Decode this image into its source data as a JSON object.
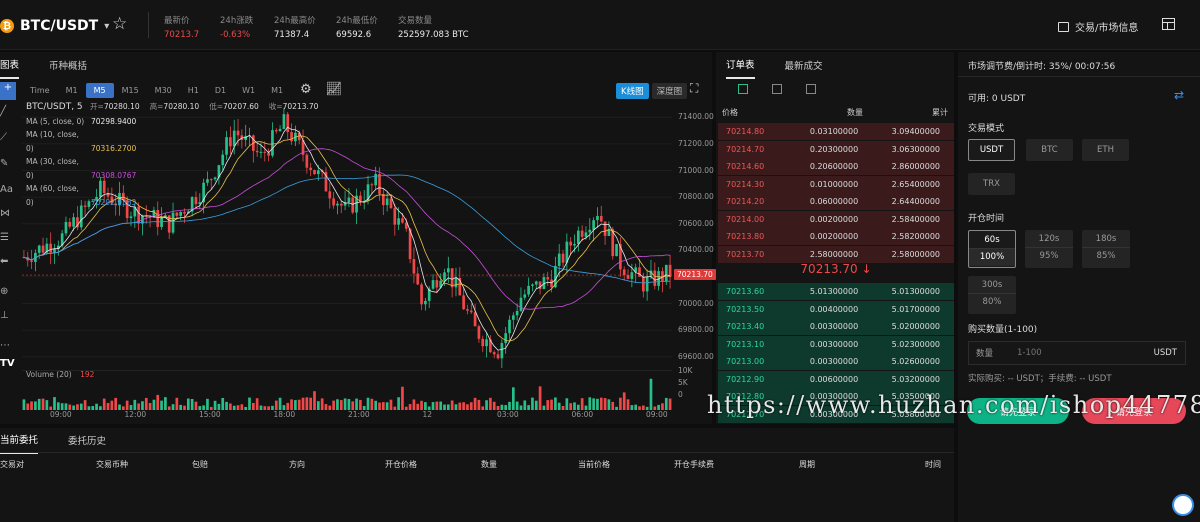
{
  "header": {
    "pair": "BTC/USDT",
    "coin_glyph": "₿",
    "stats": [
      {
        "label": "最新价",
        "value": "70213.7",
        "color": "red"
      },
      {
        "label": "24h涨跌",
        "value": "-0.63%",
        "color": "red"
      },
      {
        "label": "24h最高价",
        "value": "71387.4",
        "color": "white"
      },
      {
        "label": "24h最低价",
        "value": "69592.6",
        "color": "white"
      },
      {
        "label": "交易数量",
        "value": "252597.083 BTC",
        "color": "white"
      }
    ],
    "market_info": "交易/市场信息"
  },
  "chart_tabs": [
    "图表",
    "币种概括"
  ],
  "timeframes": [
    "Time",
    "M1",
    "M5",
    "M15",
    "M30",
    "H1",
    "D1",
    "W1",
    "M1"
  ],
  "active_timeframe": "M5",
  "view_buttons": [
    "K线图",
    "深度图"
  ],
  "legend": {
    "ohlc_title": "BTC/USDT, 5",
    "ohlc": [
      {
        "k": "开=",
        "v": "70280.10"
      },
      {
        "k": "高=",
        "v": "70280.10"
      },
      {
        "k": "低=",
        "v": "70207.60"
      },
      {
        "k": "收=",
        "v": "70213.70"
      }
    ],
    "ma": [
      {
        "label": "MA (5, close, 0)",
        "value": "70298.9400",
        "color": "#e8e8e8"
      },
      {
        "label": "MA (10, close, 0)",
        "value": "70316.2700",
        "color": "#e8c14a"
      },
      {
        "label": "MA (30, close, 0)",
        "value": "70308.0767",
        "color": "#c64fd8"
      },
      {
        "label": "MA (60, close, 0)",
        "value": "70292.9383",
        "color": "#3aa0e0"
      }
    ]
  },
  "volume_label": {
    "name": "Volume (20)",
    "value": "192"
  },
  "current_price_tag": "70213.70",
  "chart_data": {
    "type": "candlestick",
    "x_ticks": [
      "09:00",
      "12:00",
      "15:00",
      "18:00",
      "21:00",
      "12",
      "03:00",
      "06:00",
      "09:00"
    ],
    "y_ticks": [
      "71400.00",
      "71200.00",
      "71000.00",
      "70800.00",
      "70600.00",
      "70400.00",
      "70200.00",
      "70000.00",
      "69800.00",
      "69600.00"
    ],
    "ylim": [
      69500,
      71500
    ],
    "volume_ticks": [
      "10K",
      "5K",
      "0"
    ],
    "current_price": 70213.7,
    "up_color": "#28c08a",
    "down_color": "#f04848"
  },
  "orderbook": {
    "tabs": [
      "订单表",
      "最新成交"
    ],
    "headers": [
      "价格",
      "数量",
      "累计"
    ],
    "asks": [
      {
        "p": "70214.80",
        "q": "0.03100000",
        "t": "3.09400000"
      },
      {
        "p": "70214.70",
        "q": "0.20300000",
        "t": "3.06300000"
      },
      {
        "p": "70214.60",
        "q": "0.20600000",
        "t": "2.86000000"
      },
      {
        "p": "70214.30",
        "q": "0.01000000",
        "t": "2.65400000"
      },
      {
        "p": "70214.20",
        "q": "0.06000000",
        "t": "2.64400000"
      },
      {
        "p": "70214.00",
        "q": "0.00200000",
        "t": "2.58400000"
      },
      {
        "p": "70213.80",
        "q": "0.00200000",
        "t": "2.58200000"
      },
      {
        "p": "70213.70",
        "q": "2.58000000",
        "t": "2.58000000"
      }
    ],
    "mid": "70213.70 ↓",
    "bids": [
      {
        "p": "70213.60",
        "q": "5.01300000",
        "t": "5.01300000"
      },
      {
        "p": "70213.50",
        "q": "0.00400000",
        "t": "5.01700000"
      },
      {
        "p": "70213.40",
        "q": "0.00300000",
        "t": "5.02000000"
      },
      {
        "p": "70213.10",
        "q": "0.00300000",
        "t": "5.02300000"
      },
      {
        "p": "70213.00",
        "q": "0.00300000",
        "t": "5.02600000"
      },
      {
        "p": "70212.90",
        "q": "0.00600000",
        "t": "5.03200000"
      },
      {
        "p": "70212.80",
        "q": "0.00300000",
        "t": "5.03500000"
      },
      {
        "p": "70212.70",
        "q": "0.00300000",
        "t": "5.03800000"
      }
    ]
  },
  "trade": {
    "header": "市场调节费/倒计时: 35%/ 00:07:56",
    "available": "可用: 0 USDT",
    "mode_title": "交易模式",
    "modes": [
      "USDT",
      "BTC",
      "ETH",
      "TRX"
    ],
    "selected_mode": "USDT",
    "time_title": "开仓时间",
    "periods": [
      {
        "t": "60s",
        "r": "100%"
      },
      {
        "t": "120s",
        "r": "95%"
      },
      {
        "t": "180s",
        "r": "85%"
      },
      {
        "t": "300s",
        "r": "80%"
      }
    ],
    "qty_title": "购买数量(1-100)",
    "qty_label": "数量",
    "qty_placeholder": "1-100",
    "qty_unit": "USDT",
    "actual_buy": "实际购买: -- USDT；手续费: -- USDT",
    "buy_label": "请先登录",
    "sell_label": "请先登录"
  },
  "orders": {
    "tabs": [
      "当前委托",
      "委托历史"
    ],
    "headers": [
      "交易对",
      "交易币种",
      "包赔",
      "方向",
      "开仓价格",
      "数量",
      "当前价格",
      "开仓手续费",
      "周期",
      "时间"
    ]
  },
  "watermark": "https://www.huzhan.com/ishop44778"
}
